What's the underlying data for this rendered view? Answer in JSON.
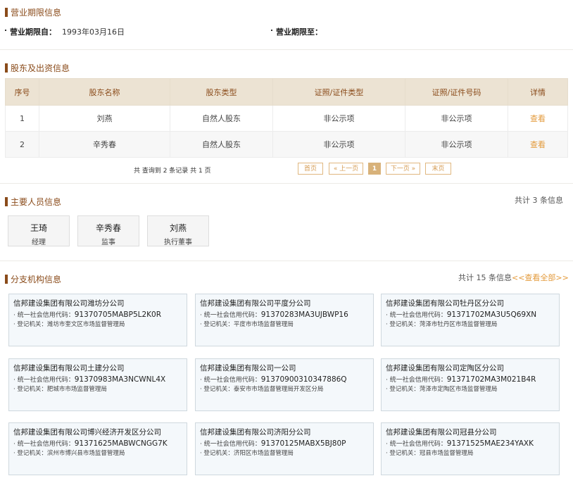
{
  "business_term": {
    "title": "营业期限信息",
    "from_label": "营业期限自：",
    "from_value": "1993年03月16日",
    "to_label": "营业期限至：",
    "to_value": ""
  },
  "shareholders": {
    "title": "股东及出资信息",
    "headers": [
      "序号",
      "股东名称",
      "股东类型",
      "证照/证件类型",
      "证照/证件号码",
      "详情"
    ],
    "rows": [
      {
        "no": "1",
        "name": "刘燕",
        "type": "自然人股东",
        "id_type": "非公示项",
        "id_no": "非公示项",
        "detail": "查看"
      },
      {
        "no": "2",
        "name": "辛秀春",
        "type": "自然人股东",
        "id_type": "非公示项",
        "id_no": "非公示项",
        "detail": "查看"
      }
    ],
    "pager": {
      "summary": "共 查询到 2 条记录 共 1 页",
      "first": "首页",
      "prev": "« 上一页",
      "current": "1",
      "next": "下一页 »",
      "last": "末页"
    }
  },
  "key_personnel": {
    "title": "主要人员信息",
    "count": "共计 3 条信息",
    "people": [
      {
        "name": "王琦",
        "role": "经理"
      },
      {
        "name": "辛秀春",
        "role": "监事"
      },
      {
        "name": "刘燕",
        "role": "执行董事"
      }
    ]
  },
  "branches": {
    "title": "分支机构信息",
    "count": "共计 15 条信息",
    "view_all": "<<查看全部>>",
    "code_label": "· 统一社会信用代码：",
    "reg_label": "· 登记机关：",
    "items": [
      {
        "name": "信邦建设集团有限公司潍坊分公司",
        "code": "91370705MABP5L2K0R",
        "reg": "潍坊市奎文区市场监督管理局"
      },
      {
        "name": "信邦建设集团有限公司平度分公司",
        "code": "91370283MA3UJBWP16",
        "reg": "平度市市场监督管理局"
      },
      {
        "name": "信邦建设集团有限公司牡丹区分公司",
        "code": "91371702MA3U5Q69XN",
        "reg": "菏泽市牡丹区市场监督管理局"
      },
      {
        "name": "信邦建设集团有限公司土建分公司",
        "code": "91370983MA3NCWNL4X",
        "reg": "肥城市市场监督管理局"
      },
      {
        "name": "信邦建设集团有限公司一公司",
        "code": "91370900310347886Q",
        "reg": "泰安市市场监督管理局开发区分局"
      },
      {
        "name": "信邦建设集团有限公司定陶区分公司",
        "code": "91371702MA3M021B4R",
        "reg": "菏泽市定陶区市场监督管理局"
      },
      {
        "name": "信邦建设集团有限公司博兴经济开发区分公司",
        "code": "91371625MABWCNGG7K",
        "reg": "滨州市博兴县市场监督管理局"
      },
      {
        "name": "信邦建设集团有限公司济阳分公司",
        "code": "91370125MABX5BJ80P",
        "reg": "济阳区市场监督管理局"
      },
      {
        "name": "信邦建设集团有限公司冠县分公司",
        "code": "91371525MAE234YAXK",
        "reg": "冠县市场监督管理局"
      }
    ]
  }
}
